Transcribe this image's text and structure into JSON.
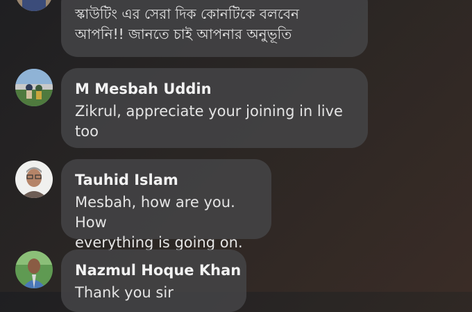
{
  "comments": [
    {
      "name": "",
      "text": "স্কাউটিং এর সেরা দিক কোনটিকে বলবেন\nআপনি!! জানতে চাই আপনার অনুভূতি"
    },
    {
      "name": "M Mesbah Uddin",
      "text": "Zikrul, appreciate your joining in live\ntoo"
    },
    {
      "name": "Tauhid Islam",
      "text": "Mesbah, how are you. How\neverything is going on."
    },
    {
      "name": "Nazmul Hoque Khan",
      "text": "Thank you sir"
    }
  ]
}
